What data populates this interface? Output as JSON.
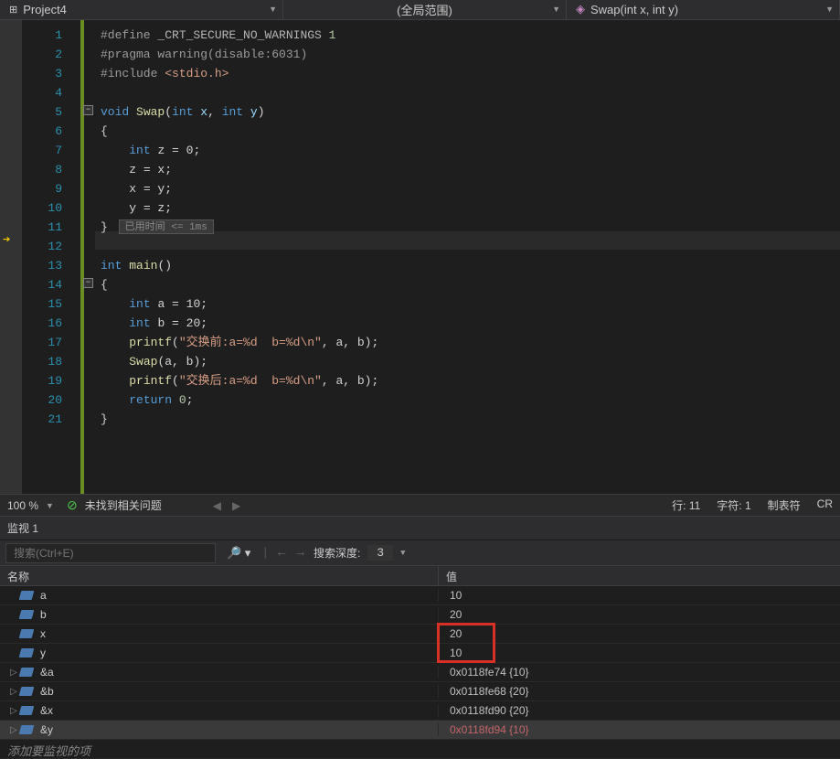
{
  "nav": {
    "project": "Project4",
    "scope": "(全局范围)",
    "function": "Swap(int x, int y)"
  },
  "editor": {
    "lines": [
      "1",
      "2",
      "3",
      "4",
      "5",
      "6",
      "7",
      "8",
      "9",
      "10",
      "11",
      "12",
      "13",
      "14",
      "15",
      "16",
      "17",
      "18",
      "19",
      "20",
      "21"
    ],
    "timing_label": "已用时间",
    "timing_value": "<= 1ms"
  },
  "code": {
    "l1_def": "#define",
    "l1_macro": "_CRT_SECURE_NO_WARNINGS",
    "l1_val": "1",
    "l2_prag": "#pragma",
    "l2_rest": "warning(disable:6031)",
    "l3_inc": "#include",
    "l3_lib": "<stdio.h>",
    "l5_void": "void",
    "l5_fn": "Swap",
    "l5_int1": "int",
    "l5_x": "x",
    "l5_int2": "int",
    "l5_y": "y",
    "l7_int": "int",
    "l7_rest": "z = 0;",
    "l8": "z = x;",
    "l9": "x = y;",
    "l10": "y = z;",
    "l13_int": "int",
    "l13_fn": "main",
    "l15_int": "int",
    "l15_rest": "a = 10;",
    "l16_int": "int",
    "l16_rest": "b = 20;",
    "l17_fn": "printf",
    "l17_str": "\"交换前:a=%d  b=%d\\n\"",
    "l17_rest": ", a, b);",
    "l18_fn": "Swap",
    "l18_rest": "(a, b);",
    "l19_fn": "printf",
    "l19_str": "\"交换后:a=%d  b=%d\\n\"",
    "l19_rest": ", a, b);",
    "l20_ret": "return",
    "l20_val": "0"
  },
  "status": {
    "zoom": "100 %",
    "issues": "未找到相关问题",
    "line": "行: 11",
    "col": "字符: 1",
    "tab": "制表符",
    "crlf": "CR"
  },
  "watch": {
    "title": "监视 1",
    "search_placeholder": "搜索(Ctrl+E)",
    "depth_label": "搜索深度:",
    "depth_value": "3",
    "columns": {
      "name": "名称",
      "value": "值"
    },
    "rows": [
      {
        "expandable": false,
        "name": "a",
        "value": "10",
        "changed": false
      },
      {
        "expandable": false,
        "name": "b",
        "value": "20",
        "changed": false
      },
      {
        "expandable": false,
        "name": "x",
        "value": "20",
        "changed": false
      },
      {
        "expandable": false,
        "name": "y",
        "value": "10",
        "changed": false
      },
      {
        "expandable": true,
        "name": "&a",
        "value": "0x0118fe74 {10}",
        "changed": false
      },
      {
        "expandable": true,
        "name": "&b",
        "value": "0x0118fe68 {20}",
        "changed": false
      },
      {
        "expandable": true,
        "name": "&x",
        "value": "0x0118fd90 {20}",
        "changed": false
      },
      {
        "expandable": true,
        "name": "&y",
        "value": "0x0118fd94 {10}",
        "changed": true,
        "selected": true
      }
    ],
    "add_placeholder": "添加要监视的项"
  }
}
